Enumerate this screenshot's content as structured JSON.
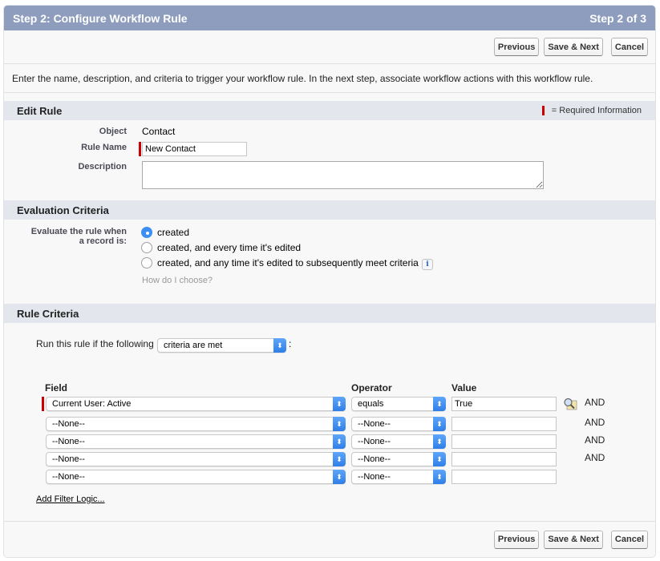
{
  "header": {
    "title": "Step 2: Configure Workflow Rule",
    "step": "Step 2 of 3"
  },
  "buttons": {
    "previous": "Previous",
    "save_next": "Save & Next",
    "cancel": "Cancel"
  },
  "intro_text": "Enter the name, description, and criteria to trigger your workflow rule. In the next step, associate workflow actions with this workflow rule.",
  "edit_rule": {
    "title": "Edit Rule",
    "required_legend": "= Required Information",
    "object_label": "Object",
    "object_value": "Contact",
    "rule_name_label": "Rule Name",
    "rule_name_value": "New Contact",
    "description_label": "Description",
    "description_value": ""
  },
  "evaluation": {
    "title": "Evaluation Criteria",
    "label_line1": "Evaluate the rule when",
    "label_line2": "a record is:",
    "options": [
      {
        "label": "created",
        "checked": true
      },
      {
        "label": "created, and every time it's edited",
        "checked": false
      },
      {
        "label": "created, and any time it's edited to subsequently meet criteria",
        "checked": false
      }
    ],
    "info_icon": "i",
    "help_link": "How do I choose?"
  },
  "rule_criteria": {
    "title": "Rule Criteria",
    "run_label": "Run this rule if the following",
    "run_select": "criteria are met",
    "run_suffix": ":",
    "columns": {
      "field": "Field",
      "operator": "Operator",
      "value": "Value"
    },
    "rows": [
      {
        "field": "Current User: Active",
        "operator": "equals",
        "value": "True",
        "conj": "AND"
      },
      {
        "field": "--None--",
        "operator": "--None--",
        "value": "",
        "conj": "AND"
      },
      {
        "field": "--None--",
        "operator": "--None--",
        "value": "",
        "conj": "AND"
      },
      {
        "field": "--None--",
        "operator": "--None--",
        "value": "",
        "conj": "AND"
      },
      {
        "field": "--None--",
        "operator": "--None--",
        "value": "",
        "conj": ""
      }
    ],
    "add_filter_logic": "Add Filter Logic..."
  },
  "colors": {
    "header_bg": "#8e9dbe",
    "section_bg": "#e3e6ed",
    "required": "#cc0000",
    "select_accent": "#3b8ff0"
  }
}
